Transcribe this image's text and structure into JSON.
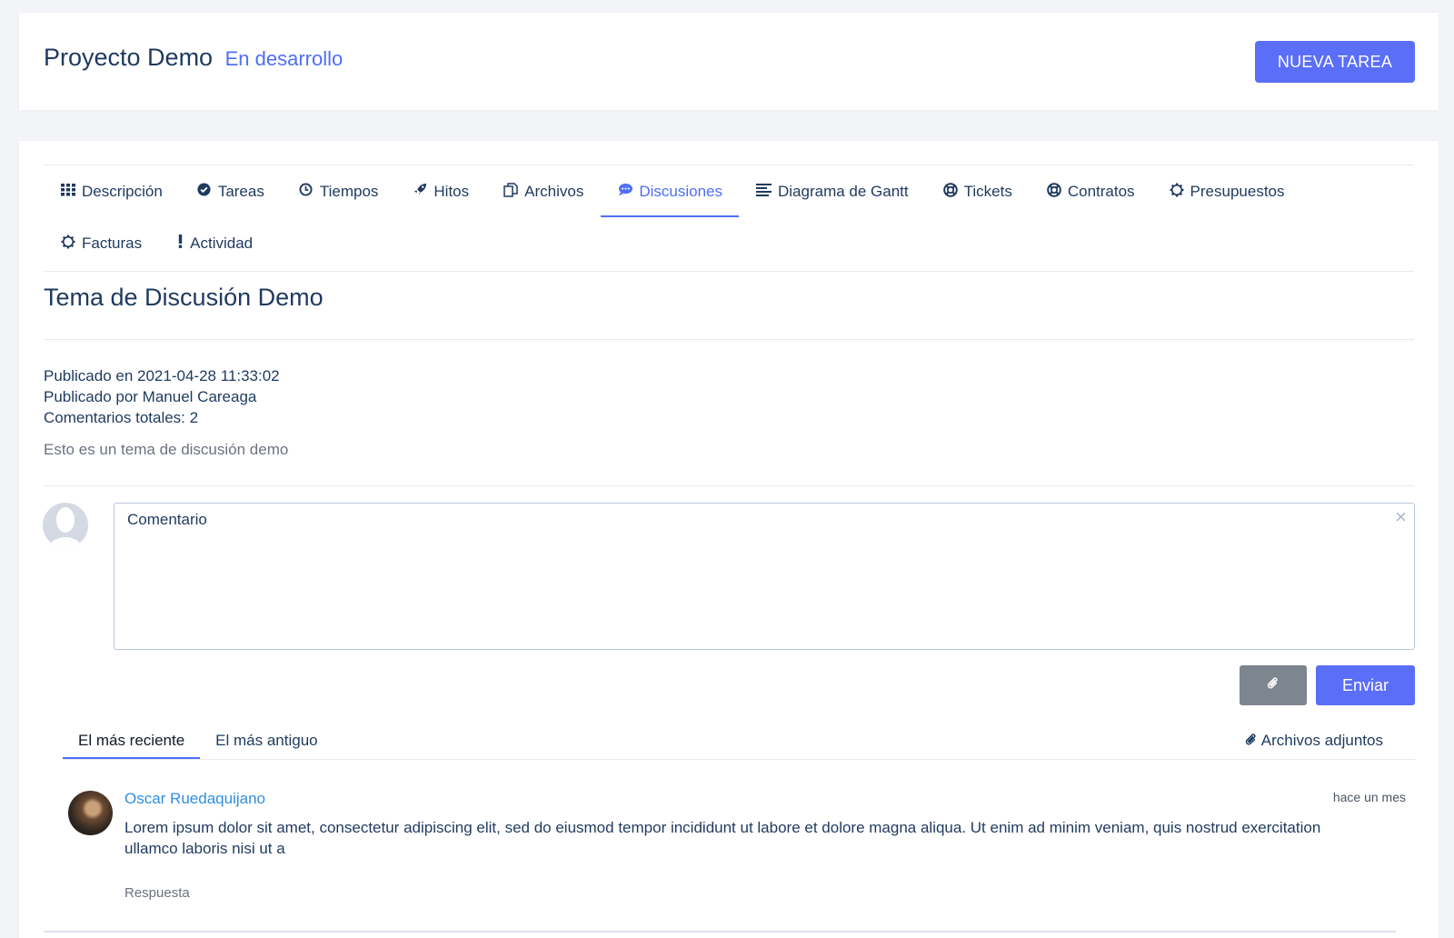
{
  "header": {
    "project_title": "Proyecto Demo",
    "project_status": "En desarrollo",
    "new_task_label": "NUEVA TAREA"
  },
  "tabs": [
    {
      "label": "Descripción",
      "icon": "grid-icon"
    },
    {
      "label": "Tareas",
      "icon": "check-circle-icon"
    },
    {
      "label": "Tiempos",
      "icon": "clock-icon"
    },
    {
      "label": "Hitos",
      "icon": "rocket-icon"
    },
    {
      "label": "Archivos",
      "icon": "files-icon"
    },
    {
      "label": "Discusiones",
      "icon": "chat-icon",
      "active": true
    },
    {
      "label": "Diagrama de Gantt",
      "icon": "bars-icon"
    },
    {
      "label": "Tickets",
      "icon": "lifebuoy-icon"
    },
    {
      "label": "Contratos",
      "icon": "lifebuoy-icon"
    },
    {
      "label": "Presupuestos",
      "icon": "gear-icon"
    },
    {
      "label": "Facturas",
      "icon": "gear-icon"
    },
    {
      "label": "Actividad",
      "icon": "exclamation-icon"
    }
  ],
  "topic": {
    "title": "Tema de Discusión Demo",
    "posted_on": "Publicado en 2021-04-28 11:33:02",
    "posted_by": "Publicado por Manuel Careaga",
    "total_comments": "Comentarios totales: 2",
    "description": "Esto es un tema de discusión demo"
  },
  "comment_form": {
    "placeholder": "Comentario",
    "close_symbol": "×",
    "attach_icon": "paperclip-icon",
    "send_label": "Enviar"
  },
  "sort": {
    "newest": "El más reciente",
    "oldest": "El más antiguo",
    "attachments": "Archivos adjuntos"
  },
  "comments": [
    {
      "author": "Oscar Ruedaquijano",
      "time": "hace un mes",
      "text": "Lorem ipsum dolor sit amet, consectetur adipiscing elit, sed do eiusmod tempor incididunt ut labore et dolore magna aliqua. Ut enim ad minim veniam, quis nostrud exercitation ullamco laboris nisi ut a",
      "reply_label": "Respuesta"
    }
  ],
  "colors": {
    "accent": "#5b6ef8",
    "link": "#2f8fe0",
    "text": "#1f3a5f"
  }
}
